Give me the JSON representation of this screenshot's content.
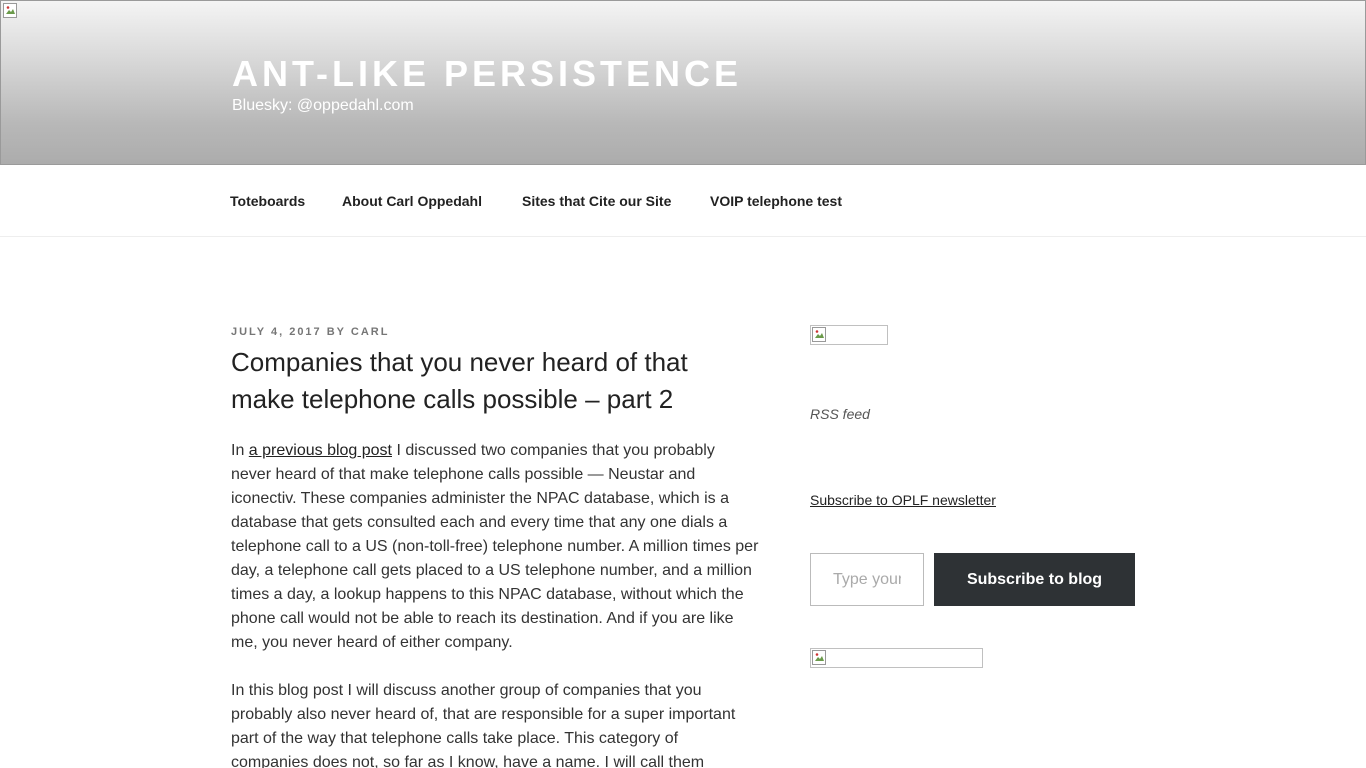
{
  "header": {
    "site_title": "ANT-LIKE PERSISTENCE",
    "site_description": "Bluesky: @oppedahl.com"
  },
  "nav": {
    "items": [
      {
        "label": "Toteboards"
      },
      {
        "label": "About Carl Oppedahl"
      },
      {
        "label": "Sites that Cite our Site"
      },
      {
        "label": "VOIP telephone test"
      }
    ]
  },
  "post": {
    "date": "JULY 4, 2017",
    "by": "BY",
    "author": "CARL",
    "title": "Companies that you never heard of that make telephone calls possible – part 2",
    "p1_before_link": "In ",
    "p1_link": "a previous blog post",
    "p1_after_link": " I discussed two companies that you probably never heard of that make telephone calls possible — Neustar and iconectiv.  These companies administer the NPAC database, which is a database that gets consulted each and every time that any one dials a telephone call to a US (non-toll-free) telephone number.  A million times per day, a telephone call gets placed to a US telephone number, and a million times a day, a lookup happens to this NPAC database, without which the phone call would not be able to reach its destination.  And if you are like me, you never heard of either company.",
    "p2": "In this blog post I will discuss another group of companies that you probably also never heard of, that are responsible for a super important part of the way that telephone calls take place.  This category of companies does not, so far as I know, have a name.  I will call them"
  },
  "sidebar": {
    "rss_label": "RSS feed",
    "newsletter_link": "Subscribe to OPLF newsletter",
    "subscribe_placeholder": "Type your email…",
    "subscribe_button": "Subscribe to blog"
  }
}
